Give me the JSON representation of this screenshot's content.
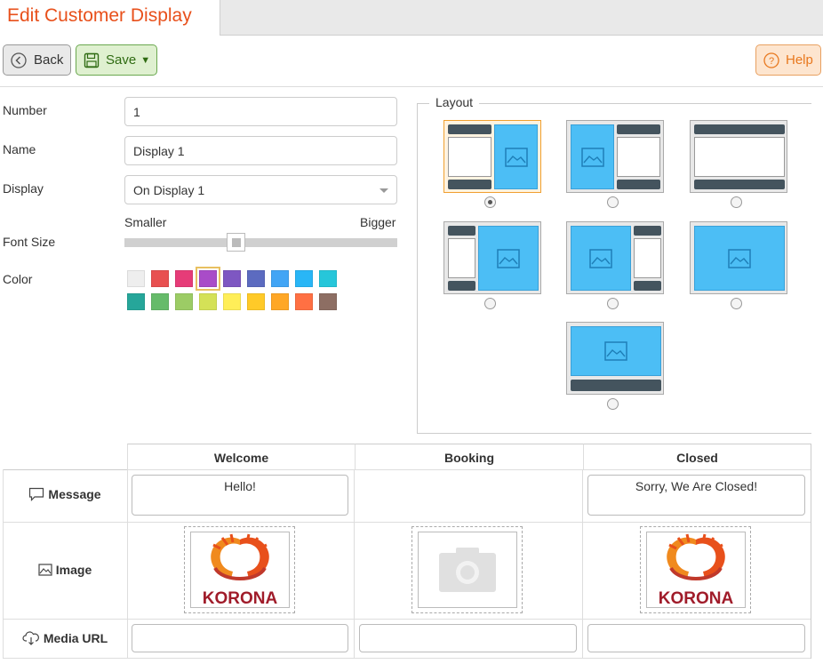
{
  "tab": {
    "title": "Edit Customer Display"
  },
  "toolbar": {
    "back_label": "Back",
    "save_label": "Save",
    "help_label": "Help"
  },
  "form": {
    "number_label": "Number",
    "number_value": "1",
    "name_label": "Name",
    "name_value": "Display 1",
    "display_label": "Display",
    "display_value": "On Display 1",
    "font_size_label": "Font Size",
    "font_smaller": "Smaller",
    "font_bigger": "Bigger",
    "font_size_level": 0.4,
    "color_label": "Color",
    "colors_row1": [
      "#eeeeee",
      "#e85050",
      "#e63c78",
      "#a94cc8",
      "#7e57c2",
      "#5c6bc0",
      "#42a5f5",
      "#29b6f6",
      "#26c6da"
    ],
    "colors_row2": [
      "#26a69a",
      "#66bb6a",
      "#9ccc65",
      "#d4e157",
      "#ffee58",
      "#ffca28",
      "#ffa726",
      "#ff7043",
      "#8d6e63"
    ],
    "selected_color": "#a94cc8"
  },
  "layout": {
    "title": "Layout",
    "selected_index": 0
  },
  "content": {
    "columns": [
      "Welcome",
      "Booking",
      "Closed"
    ],
    "rows": {
      "message": "Message",
      "image": "Image",
      "media_url": "Media URL"
    },
    "messages": [
      "Hello!",
      "",
      "Sorry, We Are Closed!"
    ],
    "logo_text": "KORONA"
  }
}
